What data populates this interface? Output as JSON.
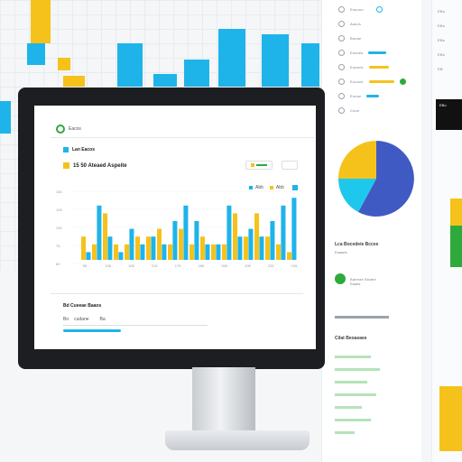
{
  "background": {
    "bars": [
      {
        "color": "#f5c21b"
      },
      {
        "color": "#1eb4ea"
      },
      {
        "color": "#f5c21b"
      }
    ]
  },
  "screen": {
    "header_label": "Eacos",
    "section_label": "Lan Eacos",
    "title": "15 50 Ateaed Aspeite",
    "legend": [
      "Abb",
      "Abb"
    ],
    "y_ticks": [
      "150",
      "125",
      "100",
      "75",
      "60"
    ],
    "x_ticks": [
      "55",
      "105",
      "165",
      "215",
      "175",
      "185",
      "265",
      "105",
      "225",
      "105"
    ],
    "footer_title": "Bd Cueeae Baaos",
    "footer_items": [
      "Bo",
      "cudane",
      "Ba"
    ]
  },
  "chart_data": {
    "type": "bar",
    "values_yellow": [
      3,
      2,
      6,
      2,
      2,
      3,
      3,
      4,
      2,
      4,
      2,
      3,
      2,
      2,
      6,
      3,
      6,
      3,
      2,
      1
    ],
    "values_blue": [
      1,
      7,
      3,
      1,
      4,
      2,
      3,
      2,
      5,
      7,
      5,
      2,
      2,
      7,
      3,
      4,
      3,
      5,
      7,
      8
    ],
    "colors": {
      "yellow": "#f5c21b",
      "blue": "#1eb4ea"
    }
  },
  "right_panel": {
    "rows": [
      "Eosooo",
      "Aaccs",
      "Boose",
      "Eosses",
      "Eoaecs",
      "Eoocce",
      "Eoose",
      "Cooe"
    ],
    "pie_heading": "Lca Bocedeie Bccee",
    "pie_sub": "Eaaaes",
    "item_label": "Baeeae Bdaee",
    "item_sub": "Eaaes",
    "list_heading": "Cilat Beoaeaee",
    "pie": {
      "blue": 0.62,
      "yellow": 0.24,
      "cyan": 0.14
    }
  },
  "far_right": {
    "items": [
      "EBs",
      "EBs",
      "EBs",
      "EBs",
      "EB"
    ],
    "badge": "EBo"
  }
}
